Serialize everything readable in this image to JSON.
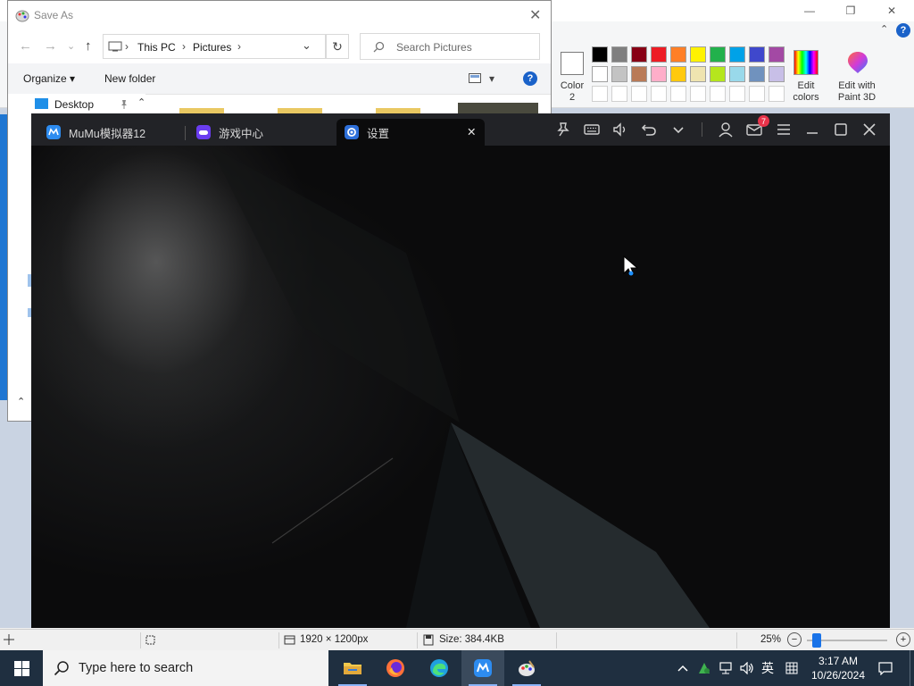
{
  "paint": {
    "window_controls": {
      "minimize": "—",
      "maximize": "❐",
      "close": "✕"
    },
    "collapse_icon": "⌃",
    "help_label": "?",
    "color2_label": "Color\n2",
    "edit_colors_label": "Edit\ncolors",
    "edit_paint3d_label": "Edit with\nPaint 3D",
    "palette_row1": [
      "#000000",
      "#7f7f7f",
      "#880015",
      "#ed1c24",
      "#ff7f27",
      "#fff200",
      "#22b14c",
      "#00a2e8",
      "#3f48cc",
      "#a349a4"
    ],
    "palette_row2": [
      "#ffffff",
      "#c3c3c3",
      "#b97a57",
      "#ffaec9",
      "#ffc90e",
      "#efe4b0",
      "#b5e61d",
      "#99d9ea",
      "#7092be",
      "#c8bfe7"
    ],
    "palette_row3": [
      "#ffffff",
      "#ffffff",
      "#ffffff",
      "#ffffff",
      "#ffffff",
      "#ffffff",
      "#ffffff",
      "#ffffff",
      "#ffffff",
      "#ffffff"
    ]
  },
  "save_as": {
    "title": "Save As",
    "close": "✕",
    "nav": {
      "back": "←",
      "forward": "→",
      "recent": "⌄",
      "up": "↑"
    },
    "breadcrumb": [
      "This PC",
      "Pictures"
    ],
    "breadcrumb_sep": "›",
    "address_dropdown": "⌄",
    "refresh": "↻",
    "search_placeholder": "Search Pictures",
    "toolbar": {
      "organize": "Organize ▾",
      "new_folder": "New folder",
      "view_caret": "▾",
      "help": "?"
    },
    "nav_pane": {
      "desktop": "Desktop",
      "scroll_up": "⌃",
      "scroll_down": "⌃"
    }
  },
  "mumu": {
    "tabs": [
      {
        "label": "MuMu模拟器12"
      },
      {
        "label": "游戏中心"
      },
      {
        "label": "设置"
      }
    ],
    "tab_close": "✕",
    "mail_badge": "7"
  },
  "statusbar": {
    "dimensions": "1920 × 1200px",
    "size": "Size: 384.4KB",
    "zoom": "25%",
    "zoom_out": "−",
    "zoom_in": "+",
    "zoom_level": 0.25
  },
  "taskbar": {
    "search_placeholder": "Type here to search",
    "ime": "英",
    "time": "3:17 AM",
    "date": "10/26/2024"
  }
}
